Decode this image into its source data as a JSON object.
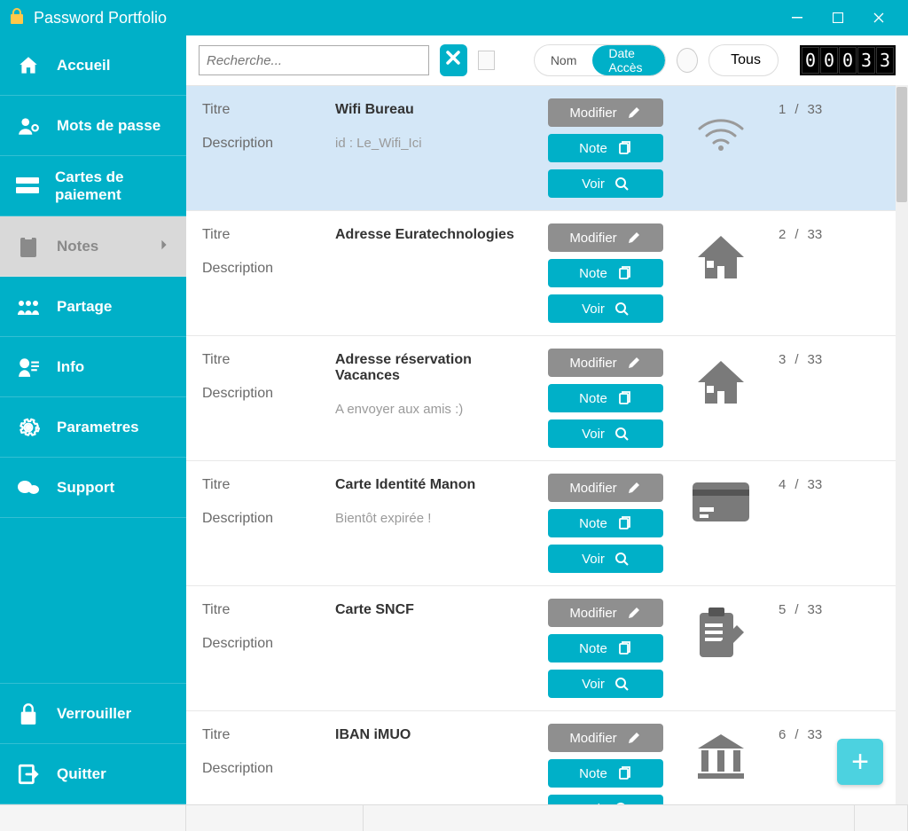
{
  "app": {
    "title": "Password Portfolio"
  },
  "sidebar": {
    "items": [
      {
        "label": "Accueil",
        "icon": "home"
      },
      {
        "label": "Mots de passe",
        "icon": "key-user"
      },
      {
        "label": "Cartes de paiement",
        "icon": "card"
      },
      {
        "label": "Notes",
        "icon": "clipboard",
        "active": true
      },
      {
        "label": "Partage",
        "icon": "share"
      },
      {
        "label": "Info",
        "icon": "info"
      },
      {
        "label": "Parametres",
        "icon": "gear"
      },
      {
        "label": "Support",
        "icon": "support"
      }
    ],
    "bottom": [
      {
        "label": "Verrouiller",
        "icon": "lock"
      },
      {
        "label": "Quitter",
        "icon": "exit"
      }
    ]
  },
  "toolbar": {
    "search_placeholder": "Recherche...",
    "sort": {
      "opt1": "Nom",
      "opt2": "Date Accès",
      "active": "opt2"
    },
    "filter": {
      "label": "Tous"
    },
    "counter": "00033"
  },
  "labels": {
    "title": "Titre",
    "description": "Description",
    "modify": "Modifier",
    "note": "Note",
    "view": "Voir",
    "slash": "/"
  },
  "total": 33,
  "items": [
    {
      "index": 1,
      "title": "Wifi Bureau",
      "description": "id : Le_Wifi_Ici",
      "icon": "wifi",
      "selected": true
    },
    {
      "index": 2,
      "title": "Adresse Euratechnologies",
      "description": "",
      "icon": "house"
    },
    {
      "index": 3,
      "title": "Adresse réservation Vacances",
      "description": "A envoyer aux amis :)",
      "icon": "house"
    },
    {
      "index": 4,
      "title": "Carte Identité Manon",
      "description": "Bientôt expirée !",
      "icon": "id-card"
    },
    {
      "index": 5,
      "title": "Carte SNCF",
      "description": "",
      "icon": "clipboard-pen"
    },
    {
      "index": 6,
      "title": "IBAN iMUO",
      "description": "",
      "icon": "bank"
    }
  ]
}
